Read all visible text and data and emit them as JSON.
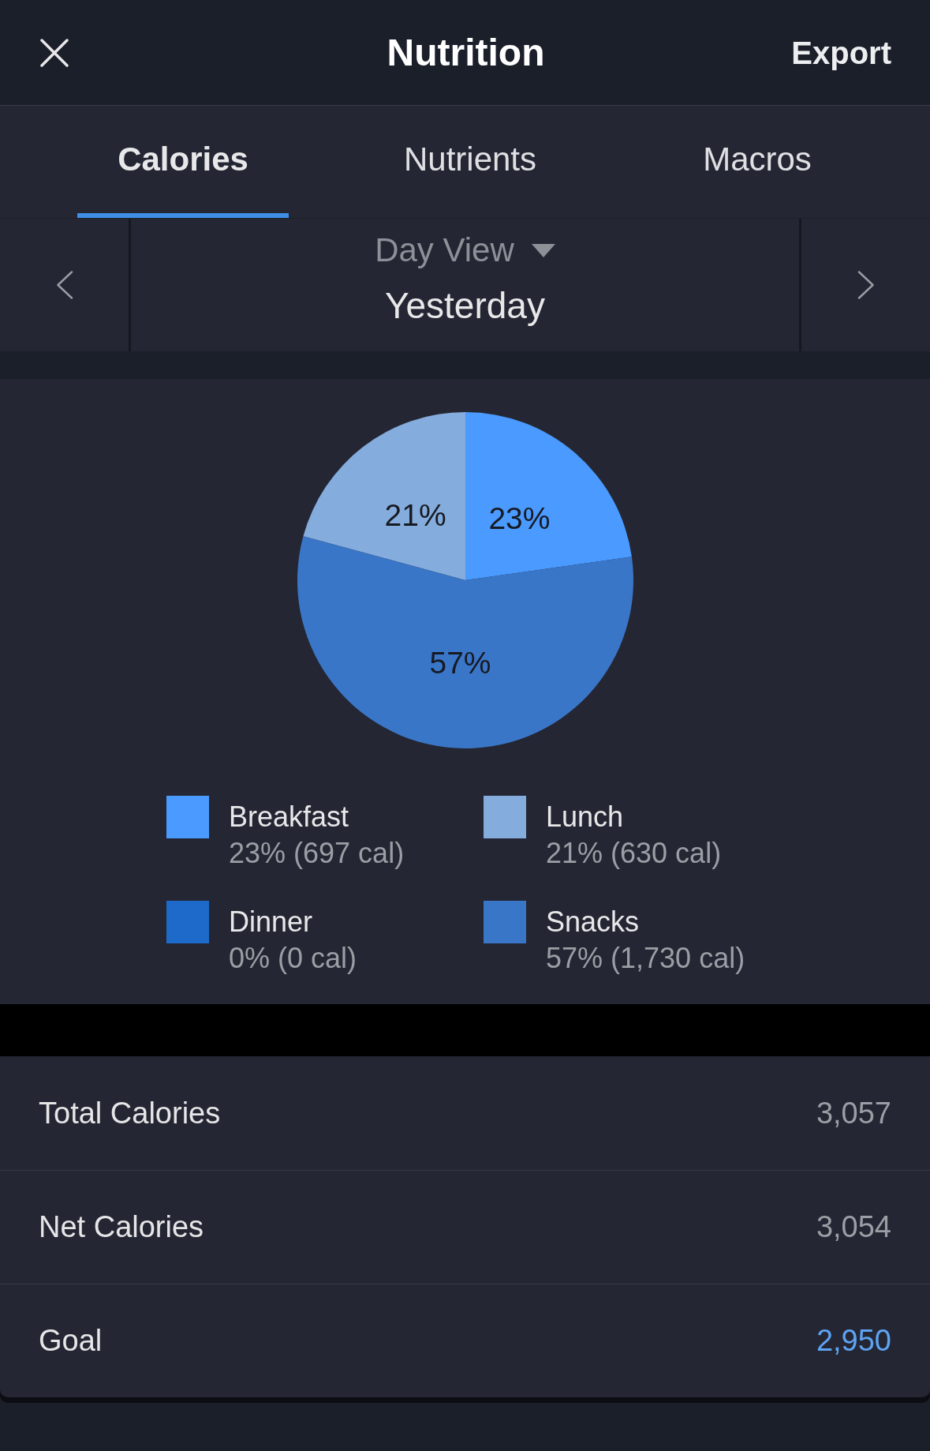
{
  "header": {
    "title": "Nutrition",
    "action": "Export"
  },
  "tabs": [
    {
      "label": "Calories",
      "selected": true
    },
    {
      "label": "Nutrients",
      "selected": false
    },
    {
      "label": "Macros",
      "selected": false
    }
  ],
  "date_selector": {
    "view": "Day View",
    "date": "Yesterday"
  },
  "chart": {
    "chart_data": {
      "type": "pie",
      "categories": [
        "Breakfast",
        "Lunch",
        "Dinner",
        "Snacks"
      ],
      "values": [
        23,
        21,
        0,
        57
      ],
      "colors": [
        "#4a9aff",
        "#84acdc",
        "#1d6acb",
        "#3a76c8"
      ],
      "value_labels": [
        "23%",
        "21%",
        null,
        "57%"
      ]
    },
    "legend_details": [
      "23% (697 cal)",
      "21% (630 cal)",
      "0% (0 cal)",
      "57% (1,730 cal)"
    ]
  },
  "summary": [
    {
      "label": "Total Calories",
      "value": "3,057",
      "highlighted": false
    },
    {
      "label": "Net Calories",
      "value": "3,054",
      "highlighted": false
    },
    {
      "label": "Goal",
      "value": "2,950",
      "highlighted": true
    }
  ]
}
